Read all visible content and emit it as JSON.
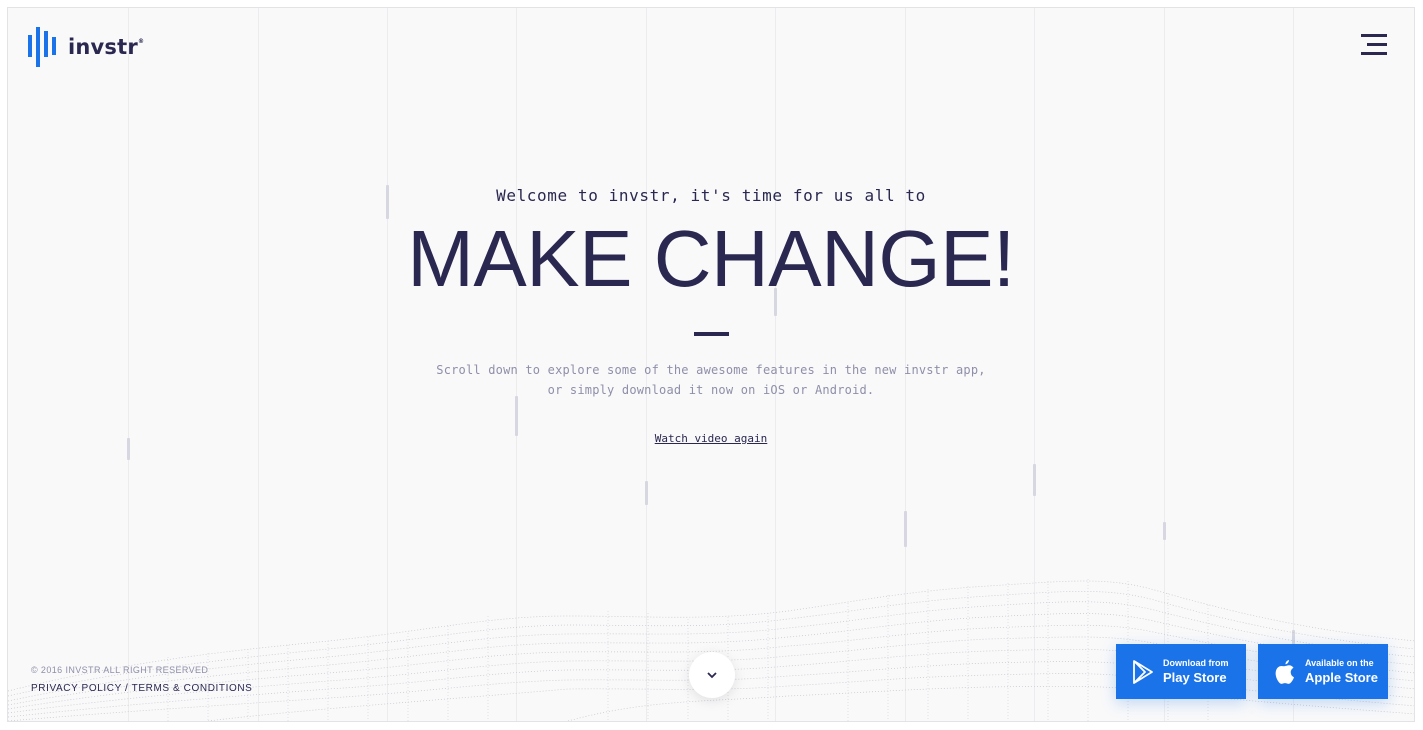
{
  "brand": {
    "name": "invstr",
    "trademark": "®",
    "accent_color": "#1a73e8",
    "text_color": "#2a2850"
  },
  "nav": {
    "menu_icon": "hamburger-icon"
  },
  "hero": {
    "welcome": "Welcome to invstr, it's time for us all to",
    "headline": "MAKE CHANGE!",
    "description_line1": "Scroll down to explore some of the awesome features in the new invstr app,",
    "description_line2": "or simply download it now on iOS or Android.",
    "watch_link": "Watch video again"
  },
  "footer": {
    "copyright": "© 2016 INVSTR ALL RIGHT RESERVED",
    "privacy": "PRIVACY POLICY",
    "separator": "/",
    "terms": "TERMS & CONDITIONS"
  },
  "scroll": {
    "icon": "chevron-down-icon"
  },
  "stores": {
    "play": {
      "small": "Download from",
      "big": "Play Store",
      "icon": "play-store-icon"
    },
    "apple": {
      "small": "Available on the",
      "big": "Apple Store",
      "icon": "apple-icon"
    }
  }
}
